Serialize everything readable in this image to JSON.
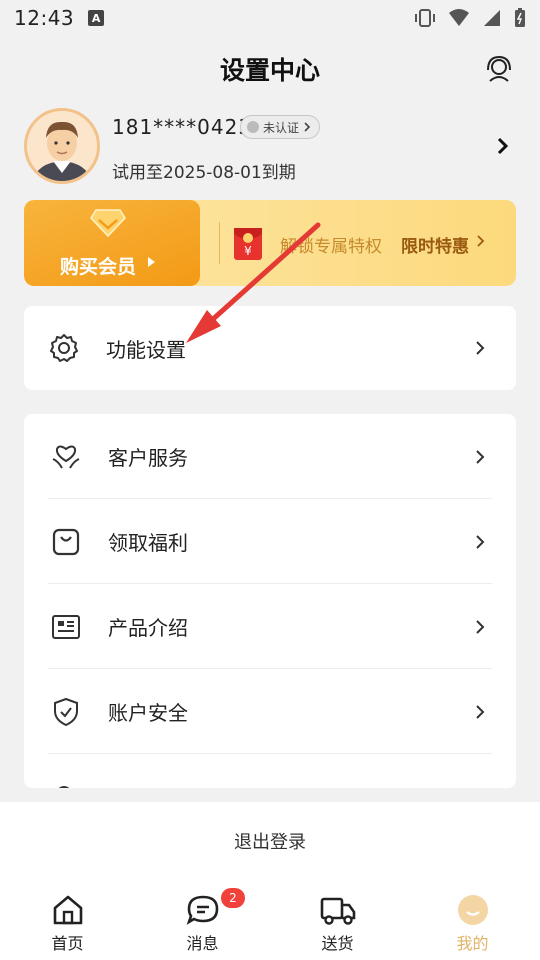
{
  "status": {
    "time": "12:43"
  },
  "header": {
    "title": "设置中心"
  },
  "profile": {
    "phone": "181****0423",
    "verify_label": "未认证",
    "expire_text": "试用至2025-08-01到期"
  },
  "member": {
    "buy_label": "购买会员",
    "unlock_text": "解锁专属特权",
    "promo_label": "限时特惠"
  },
  "settings_card": {
    "items": [
      {
        "label": "功能设置",
        "icon": "gear-icon"
      }
    ]
  },
  "menu": {
    "items": [
      {
        "label": "客户服务",
        "icon": "heart-hand-icon"
      },
      {
        "label": "领取福利",
        "icon": "bag-icon"
      },
      {
        "label": "产品介绍",
        "icon": "document-icon"
      },
      {
        "label": "账户安全",
        "icon": "shield-icon"
      }
    ]
  },
  "logout_label": "退出登录",
  "bottom_nav": {
    "items": [
      {
        "label": "首页",
        "icon": "home-icon"
      },
      {
        "label": "消息",
        "icon": "message-icon",
        "badge": "2"
      },
      {
        "label": "送货",
        "icon": "truck-icon"
      },
      {
        "label": "我的",
        "icon": "profile-icon",
        "active": true
      }
    ]
  },
  "colors": {
    "accent": "#f39a16",
    "active_tab": "#e0b466",
    "badge": "#f0413a",
    "annotation_arrow": "#e53935"
  }
}
